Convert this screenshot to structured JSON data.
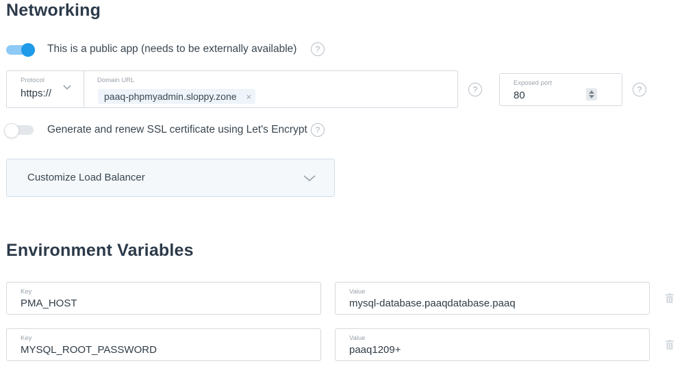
{
  "networking": {
    "title": "Networking",
    "public_app_label": "This is a public app (needs to be externally available)",
    "public_app_enabled": true,
    "protocol": {
      "label": "Protocol",
      "value": "https://"
    },
    "domain": {
      "label": "Domain URL",
      "chip": "paaq-phpmyadmin.sloppy.zone",
      "chip_remove": "×"
    },
    "port": {
      "label": "Exposed port",
      "value": "80"
    },
    "ssl_label": "Generate and renew SSL certificate using Let's Encrypt",
    "ssl_enabled": false,
    "load_balancer_label": "Customize Load Balancer",
    "help_glyph": "?"
  },
  "env": {
    "title": "Environment Variables",
    "rows": [
      {
        "key_label": "Key",
        "key": "PMA_HOST",
        "value_label": "Value",
        "value": "mysql-database.paaqdatabase.paaq"
      },
      {
        "key_label": "Key",
        "key": "MYSQL_ROOT_PASSWORD",
        "value_label": "Value",
        "value": "paaq1209+"
      }
    ]
  },
  "colors": {
    "accent": "#1e9ae8",
    "accent_track": "#8dcaf5",
    "heading": "#2c3a4a",
    "panel_bg": "#f4f8fb",
    "border": "#d3d9df"
  }
}
